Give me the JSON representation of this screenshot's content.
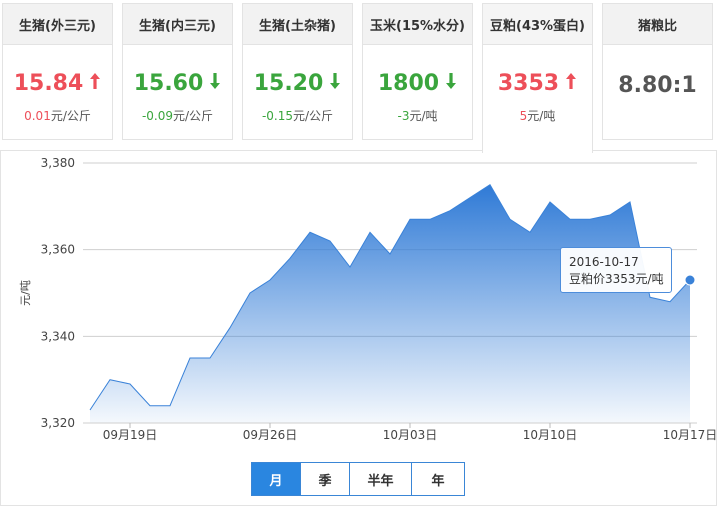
{
  "tiles": [
    {
      "title": "生猪(外三元)",
      "value": "15.84",
      "direction": "up",
      "change": "0.01",
      "unit": "元/公斤"
    },
    {
      "title": "生猪(内三元)",
      "value": "15.60",
      "direction": "down",
      "change": "-0.09",
      "unit": "元/公斤"
    },
    {
      "title": "生猪(土杂猪)",
      "value": "15.20",
      "direction": "down",
      "change": "-0.15",
      "unit": "元/公斤"
    },
    {
      "title": "玉米(15%水分)",
      "value": "1800",
      "direction": "down",
      "change": "-3",
      "unit": "元/吨"
    },
    {
      "title": "豆粕(43%蛋白)",
      "value": "3353",
      "direction": "up",
      "change": "5",
      "unit": "元/吨"
    },
    {
      "title": "猪粮比",
      "value": "8.80:1",
      "direction": "flat",
      "change": "",
      "unit": ""
    }
  ],
  "colors": {
    "up": "#ed4f59",
    "down": "#3aa53d",
    "accent": "#2a86e0",
    "line": "#3a82d8"
  },
  "tooltip": {
    "date": "2016-10-17",
    "text": "豆粕价3353元/吨"
  },
  "range_tabs": [
    {
      "label": "月",
      "active": true
    },
    {
      "label": "季",
      "active": false
    },
    {
      "label": "半年",
      "active": false
    },
    {
      "label": "年",
      "active": false
    }
  ],
  "chart_data": {
    "type": "area",
    "ylabel": "元/吨",
    "ylim": [
      3320,
      3380
    ],
    "yticks": [
      3320,
      3340,
      3360,
      3380
    ],
    "ytick_labels": [
      "3,320",
      "3,340",
      "3,360",
      "3,380"
    ],
    "xlim": [
      "2016-09-17",
      "2016-10-17"
    ],
    "xticks": [
      "2016-09-19",
      "2016-09-26",
      "2016-10-03",
      "2016-10-10",
      "2016-10-17"
    ],
    "xtick_labels": [
      "09月19日",
      "09月26日",
      "10月03日",
      "10月10日",
      "10月17日"
    ],
    "grid": true,
    "x": [
      "2016-09-17",
      "2016-09-18",
      "2016-09-19",
      "2016-09-20",
      "2016-09-21",
      "2016-09-22",
      "2016-09-23",
      "2016-09-24",
      "2016-09-25",
      "2016-09-26",
      "2016-09-27",
      "2016-09-28",
      "2016-09-29",
      "2016-09-30",
      "2016-10-01",
      "2016-10-02",
      "2016-10-03",
      "2016-10-04",
      "2016-10-05",
      "2016-10-06",
      "2016-10-07",
      "2016-10-08",
      "2016-10-09",
      "2016-10-10",
      "2016-10-11",
      "2016-10-12",
      "2016-10-13",
      "2016-10-14",
      "2016-10-15",
      "2016-10-16",
      "2016-10-17"
    ],
    "series": [
      {
        "values": [
          3323,
          3330,
          3329,
          3324,
          3324,
          3335,
          3335,
          3342,
          3350,
          3353,
          3358,
          3364,
          3362,
          3356,
          3364,
          3359,
          3367,
          3367,
          3369,
          3372,
          3375,
          3367,
          3364,
          3371,
          3367,
          3367,
          3368,
          3371,
          3349,
          3348,
          3353
        ]
      }
    ],
    "highlight_index": 30
  }
}
